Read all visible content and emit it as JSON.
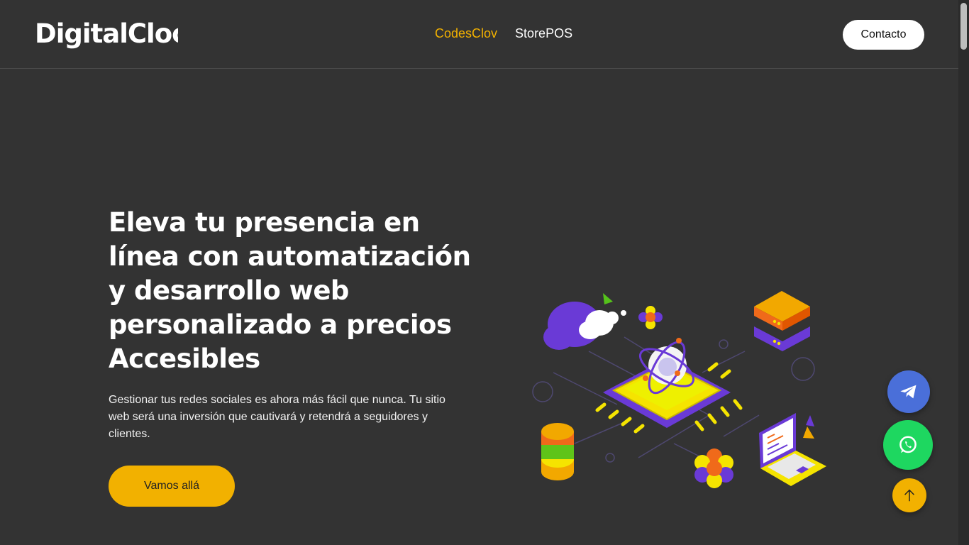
{
  "header": {
    "logo": "DigitalCloc",
    "nav": [
      {
        "label": "CodesClov",
        "active": true
      },
      {
        "label": "StorePOS",
        "active": false
      }
    ],
    "contact_label": "Contacto"
  },
  "hero": {
    "title": "Eleva tu presencia en línea con automatización y desarrollo web personalizado a precios Accesibles",
    "text": "Gestionar tus redes sociales es ahora más fácil que nunca. Tu sitio web será una inversión que cautivará y retendrá a seguidores y clientes.",
    "cta_label": "Vamos allá"
  },
  "floating_buttons": [
    {
      "name": "telegram",
      "icon": "telegram-icon"
    },
    {
      "name": "whatsapp",
      "icon": "whatsapp-icon"
    },
    {
      "name": "scroll-top",
      "icon": "arrow-up-icon"
    }
  ],
  "colors": {
    "background": "#333333",
    "accent": "#f2b100",
    "telegram": "#4a6fd9",
    "whatsapp": "#1ed760"
  }
}
